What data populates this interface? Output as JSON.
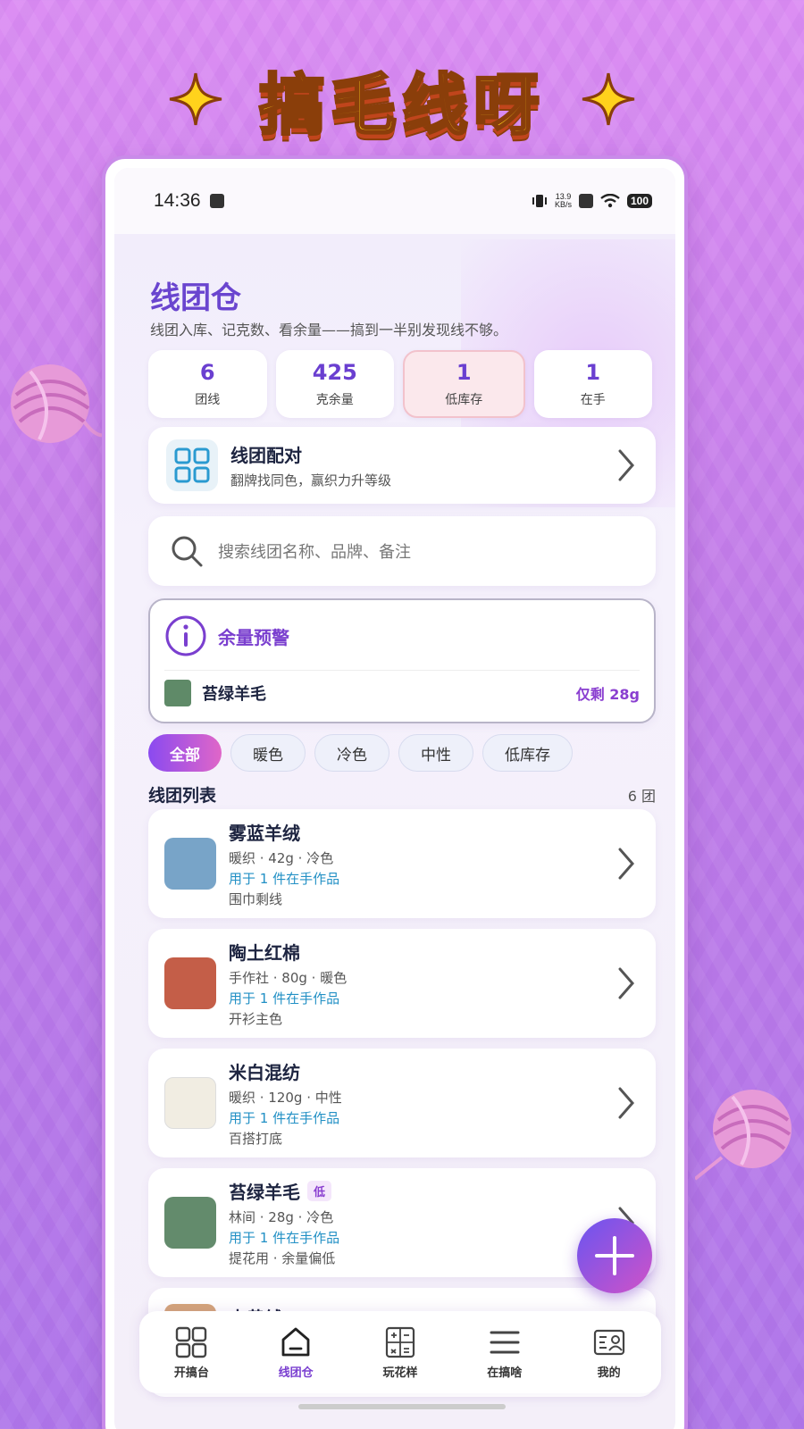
{
  "banner": {
    "title": "搞毛线呀"
  },
  "status": {
    "time": "14:36",
    "speed_top": "13.9",
    "speed_bottom": "KB/s",
    "battery": "100"
  },
  "header": {
    "title": "线团仓",
    "subtitle": "线团入库、记克数、看余量——搞到一半别发现线不够。"
  },
  "stats": [
    {
      "value": "6",
      "label": "团线"
    },
    {
      "value": "425",
      "label": "克余量"
    },
    {
      "value": "1",
      "label": "低库存"
    },
    {
      "value": "1",
      "label": "在手"
    }
  ],
  "pair_card": {
    "title": "线团配对",
    "subtitle": "翻牌找同色，赢织力升等级",
    "icon": "grid-icon"
  },
  "search": {
    "placeholder": "搜索线团名称、品牌、备注"
  },
  "warning": {
    "title": "余量预警",
    "item_name": "苔绿羊毛",
    "item_left": "仅剩 28g",
    "item_color": "#5f8a68"
  },
  "filters": [
    "全部",
    "暖色",
    "冷色",
    "中性",
    "低库存"
  ],
  "list": {
    "title": "线团列表",
    "count": "6 团",
    "items": [
      {
        "name": "雾蓝羊绒",
        "meta": "暖织 · 42g · 冷色",
        "use": "用于 1 件在手作品",
        "note": "围巾剩线",
        "color": "#78a4c8",
        "low": ""
      },
      {
        "name": "陶土红棉",
        "meta": "手作社 · 80g · 暖色",
        "use": "用于 1 件在手作品",
        "note": "开衫主色",
        "color": "#c45e48",
        "low": ""
      },
      {
        "name": "米白混纺",
        "meta": "暖织 · 120g · 中性",
        "use": "用于 1 件在手作品",
        "note": "百搭打底",
        "color": "#f1ede2",
        "low": ""
      },
      {
        "name": "苔绿羊毛",
        "meta": "林间 · 28g · 冷色",
        "use": "用于 1 件在手作品",
        "note": "提花用 · 余量偏低",
        "color": "#638b6c",
        "low": "低"
      },
      {
        "name": "杏黄绒",
        "meta": "",
        "use": "",
        "note": "",
        "color": "#d4a47a",
        "low": ""
      }
    ]
  },
  "tabs": [
    {
      "label": "开搞台",
      "icon": "four-squares-icon"
    },
    {
      "label": "线团仓",
      "icon": "home-icon"
    },
    {
      "label": "玩花样",
      "icon": "calculator-icon"
    },
    {
      "label": "在搞啥",
      "icon": "menu-icon"
    },
    {
      "label": "我的",
      "icon": "profile-card-icon"
    }
  ],
  "colors": {
    "accent": "#6a45cf",
    "warn_bg": "#fbe8ec",
    "link": "#2290c5"
  }
}
